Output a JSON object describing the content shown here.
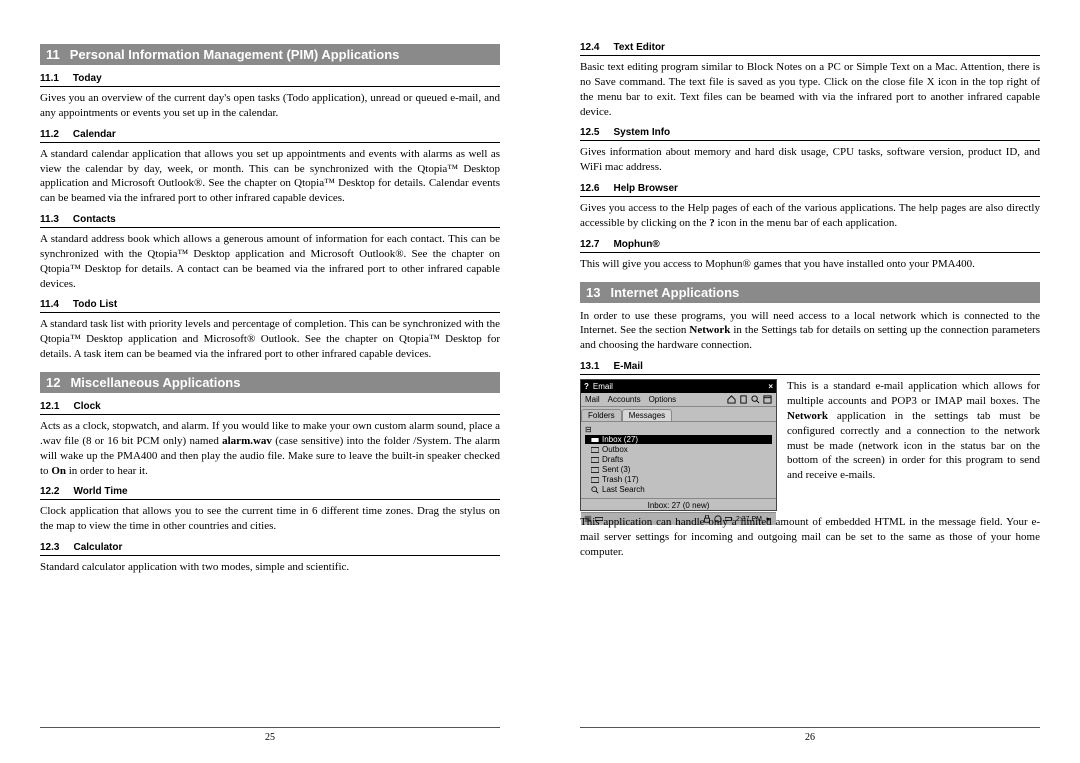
{
  "pages": {
    "left_num": "25",
    "right_num": "26"
  },
  "s11": {
    "num": "11",
    "title": "Personal Information Management (PIM) Applications",
    "subs": [
      {
        "num": "11.1",
        "title": "Today",
        "text": "Gives you an overview of the current day's open tasks (Todo application), unread or queued e-mail, and any appointments or events you set up in the calendar."
      },
      {
        "num": "11.2",
        "title": "Calendar",
        "text": "A standard calendar application that allows you set up appointments and events with alarms as well as view the calendar by day, week, or month. This can be synchronized with the Qtopia™ Desktop application and Microsoft Outlook®. See the chapter on Qtopia™ Desktop for details. Calendar events can be beamed via the infrared port to other infrared capable devices."
      },
      {
        "num": "11.3",
        "title": "Contacts",
        "text": "A standard address book which allows a generous amount of information for each contact. This can be synchronized with the Qtopia™ Desktop application and Microsoft Outlook®. See the chapter on Qtopia™ Desktop for details. A contact can be beamed via the infrared port to other infrared capable devices."
      },
      {
        "num": "11.4",
        "title": "Todo List",
        "text": "A standard task list with priority levels and percentage of completion. This can be synchronized with the Qtopia™ Desktop application and Microsoft® Outlook. See the chapter on Qtopia™ Desktop for details. A task item can be beamed via the infrared port to other infrared capable devices."
      }
    ]
  },
  "s12": {
    "num": "12",
    "title": "Miscellaneous Applications",
    "subs_left": [
      {
        "num": "12.1",
        "title": "Clock",
        "html": "Acts as a clock, stopwatch, and alarm. If you would like to make your own custom alarm sound, place a .wav file (8 or 16 bit PCM only) named <b>alarm.wav</b> (case sensitive) into the folder /System. The alarm will wake up the PMA400 and then play the audio file. Make sure to leave the built-in speaker checked to <b>On</b> in order to hear it."
      },
      {
        "num": "12.2",
        "title": "World Time",
        "text": "Clock application that allows you to see the current time in 6 different time zones. Drag the stylus on the map to view the time in other countries and cities."
      },
      {
        "num": "12.3",
        "title": "Calculator",
        "text": "Standard calculator application with two modes, simple and scientific."
      }
    ],
    "subs_right": [
      {
        "num": "12.4",
        "title": "Text Editor",
        "text": "Basic text editing program similar to Block Notes on a PC or Simple Text on a Mac. Attention, there is no Save command. The text file is saved as you type. Click on the close file X icon in the top right of the menu bar to exit. Text files can be beamed with via the infrared port to another infrared capable device."
      },
      {
        "num": "12.5",
        "title": "System Info",
        "text": "Gives information about memory and hard disk usage, CPU tasks, software version, product ID, and WiFi mac address."
      },
      {
        "num": "12.6",
        "title": "Help Browser",
        "html": "Gives you access to the Help pages of each of the various applications. The help pages are also directly accessible by clicking on the <b>?</b> icon in the menu bar of each application."
      },
      {
        "num": "12.7",
        "title": "Mophun®",
        "text": "This will give you access to Mophun® games that you have installed onto your PMA400."
      }
    ]
  },
  "s13": {
    "num": "13",
    "title": "Internet Applications",
    "intro_html": "In order to use these programs, you will need access to a local network which is connected to the Internet. See the section <b>Network</b> in the Settings tab for details on setting up the connection parameters and choosing the hardware connection.",
    "sub1": {
      "num": "13.1",
      "title": "E-Mail"
    },
    "email_beside_html": "This is a standard e-mail application which allows for multiple accounts and POP3 or IMAP mail boxes. The <b>Network</b> application in the settings tab must be configured correctly and a connection to the network must be made (network icon in the status bar on the bottom of the screen) in order for this program to send and receive e-mails.",
    "email_after": "This application can handle only a limited amount of embedded HTML in the message field. Your e-mail server settings for incoming and outgoing mail can be set to the same as those of your home computer."
  },
  "emailapp": {
    "help": "?",
    "title": "Email",
    "close": "×",
    "menu": {
      "mail": "Mail",
      "accounts": "Accounts",
      "options": "Options"
    },
    "tabs": {
      "folders": "Folders",
      "messages": "Messages"
    },
    "folders": {
      "inbox": "Inbox (27)",
      "outbox": "Outbox",
      "drafts": "Drafts",
      "sent": "Sent (3)",
      "trash": "Trash (17)",
      "last": "Last Search"
    },
    "status": "Inbox: 27 (0 new)",
    "time": "2:37 PM",
    "icons": {
      "home": "home-icon",
      "doc": "document-icon",
      "search": "search-icon",
      "lock": "lock-icon"
    }
  }
}
